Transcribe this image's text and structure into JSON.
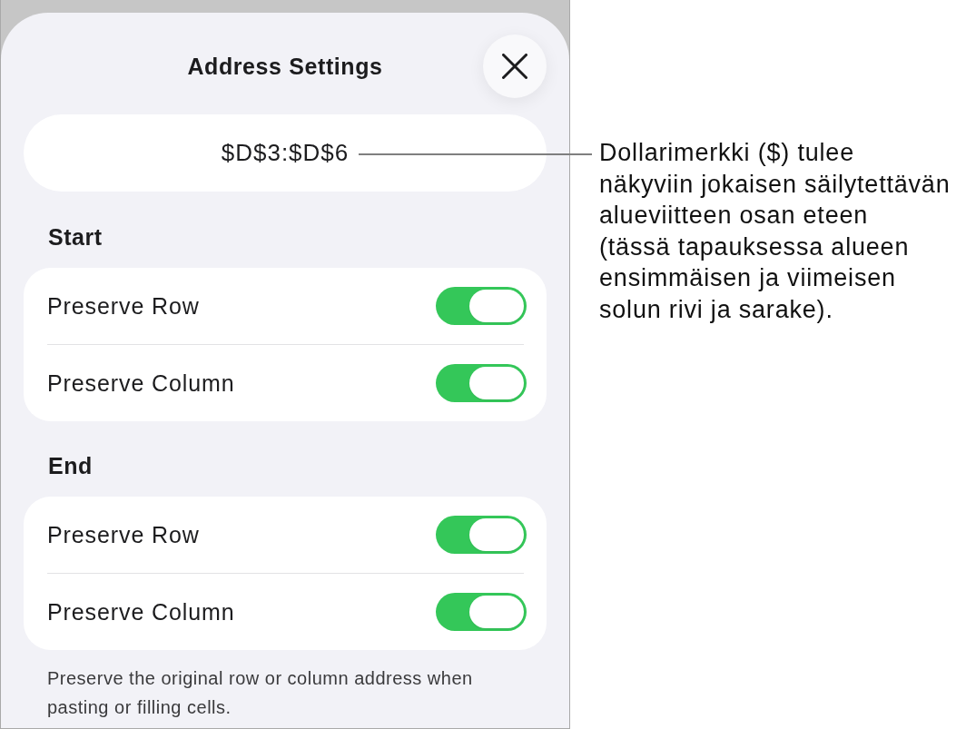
{
  "sheet": {
    "title": "Address Settings",
    "address": "$D$3:$D$6",
    "sections": [
      {
        "heading": "Start",
        "rows": [
          {
            "label": "Preserve Row",
            "on": true
          },
          {
            "label": "Preserve Column",
            "on": true
          }
        ]
      },
      {
        "heading": "End",
        "rows": [
          {
            "label": "Preserve Row",
            "on": true
          },
          {
            "label": "Preserve Column",
            "on": true
          }
        ]
      }
    ],
    "footer": "Preserve the original row or column address when pasting or filling cells."
  },
  "callout": {
    "text": "Dollarimerkki ($) tulee\nnäkyviin jokaisen säilytettävän\nalueviitteen osan eteen\n(tässä tapauksessa alueen\nensimmäisen ja viimeisen\nsolun rivi ja sarake)."
  }
}
